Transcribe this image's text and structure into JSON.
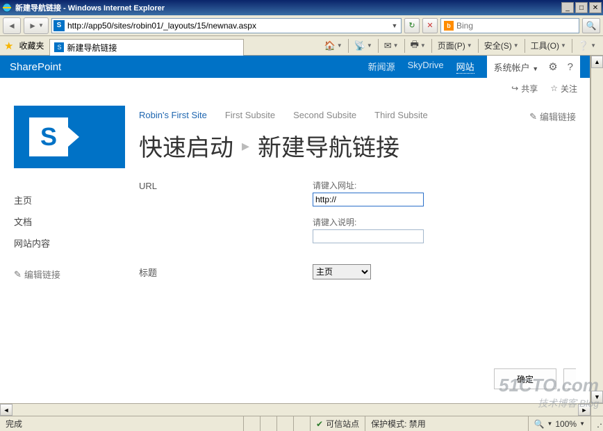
{
  "window": {
    "title": "新建导航链接 - Windows Internet Explorer"
  },
  "address": {
    "url": "http://app50/sites/robin01/_layouts/15/newnav.aspx"
  },
  "search": {
    "provider": "Bing",
    "placeholder": ""
  },
  "favbar": {
    "label": "收藏夹",
    "tab_title": "新建导航链接"
  },
  "ie_toolbar": {
    "page": "页面(P)",
    "safety": "安全(S)",
    "tools": "工具(O)"
  },
  "sp": {
    "brand": "SharePoint",
    "nav": {
      "news": "新闻源",
      "skydrive": "SkyDrive",
      "site": "网站"
    },
    "user": "系统帐户",
    "share": "共享",
    "follow": "关注",
    "crumbs": {
      "site": "Robin's First Site",
      "sub1": "First Subsite",
      "sub2": "Second Subsite",
      "sub3": "Third Subsite",
      "edit": "编辑链接"
    },
    "title": {
      "part1": "快速启动",
      "part2": "新建导航链接"
    },
    "leftnav": {
      "home": "主页",
      "docs": "文档",
      "contents": "网站内容",
      "edit": "编辑链接"
    },
    "form": {
      "url_section": "URL",
      "url_label": "请键入网址:",
      "url_value": "http://",
      "desc_label": "请键入说明:",
      "desc_value": "",
      "heading_section": "标题",
      "heading_value": "主页"
    },
    "buttons": {
      "ok": "确定"
    }
  },
  "statusbar": {
    "done": "完成",
    "trusted": "可信站点",
    "protected": "保护模式: 禁用",
    "zoom": "100%"
  },
  "watermark": {
    "l1": "51CTO.com",
    "l2": "技术博客  Blog"
  }
}
